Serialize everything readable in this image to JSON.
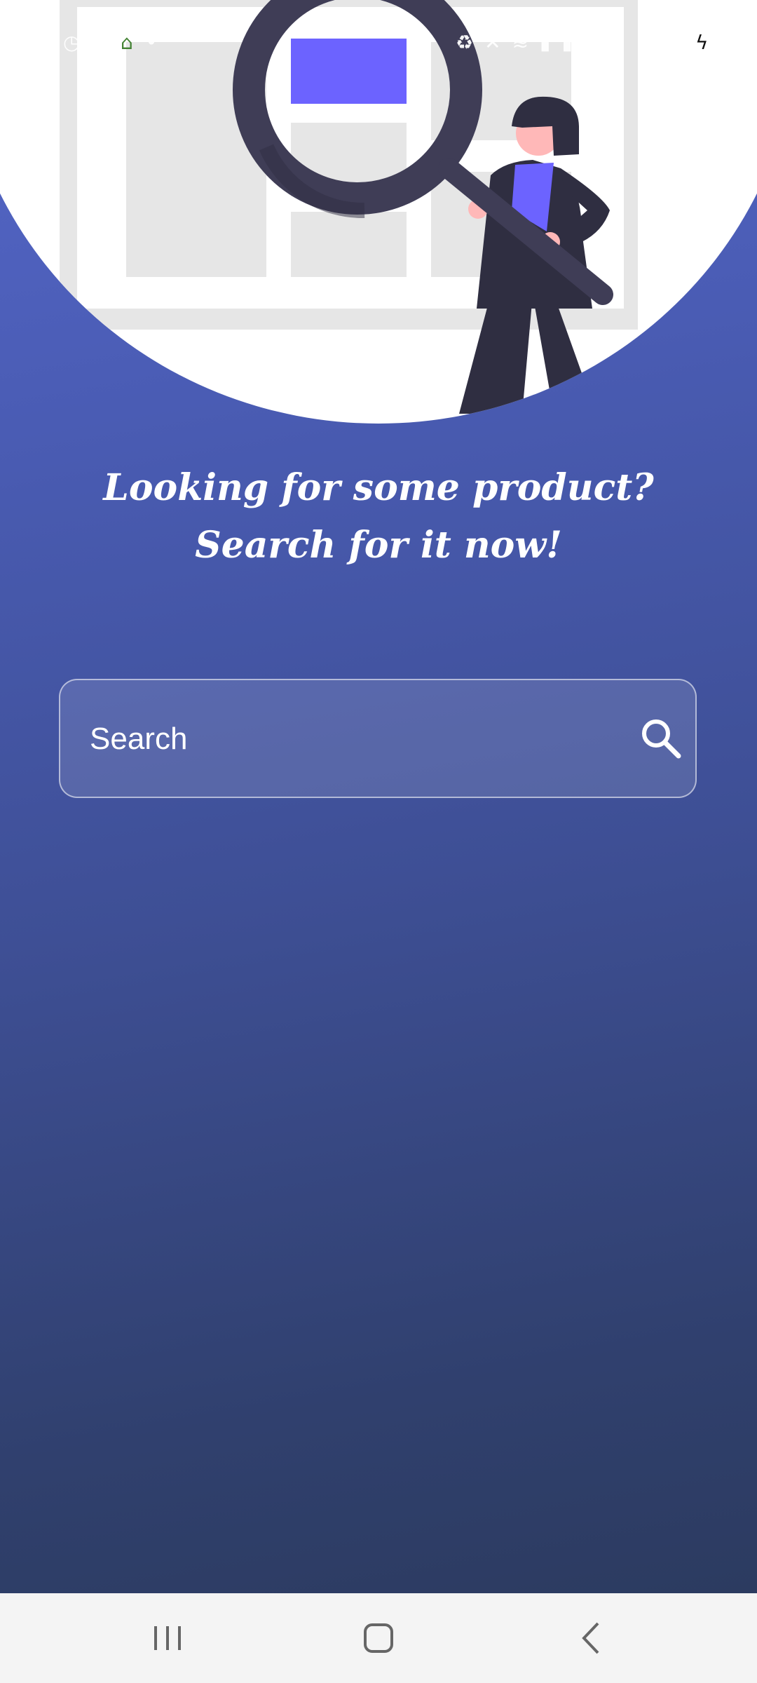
{
  "status_bar": {
    "left_icons": [
      "clock-icon",
      "youtube-icon",
      "mosque-icon",
      "dot-icon"
    ],
    "right_icons": [
      "recycle-icon",
      "mute-icon",
      "wifi-icon",
      "signal-icon",
      "signal-icon"
    ],
    "charging_icon": "bolt-icon"
  },
  "hero": {
    "illustration": "person-holding-magnifier-over-layout",
    "colors": {
      "accent": "#6c63ff",
      "dark": "#3f3d56",
      "skin": "#ffb8b8",
      "panel": "#e6e6e6"
    }
  },
  "headline": {
    "line1": "Looking for some product?",
    "line2": "Search for it now!"
  },
  "search": {
    "placeholder": "Search",
    "value": ""
  },
  "nav_bar": {
    "buttons": [
      "recents-icon",
      "home-icon",
      "back-icon"
    ]
  },
  "colors": {
    "gradient_top": "#5567c9",
    "gradient_bottom": "#2c3b60",
    "text": "#ffffff"
  }
}
